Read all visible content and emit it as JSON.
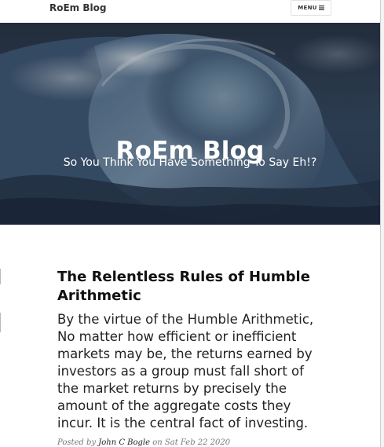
{
  "navbar": {
    "brand": "RoEm Blog",
    "menu_label": "MENU",
    "menu_icon": "hamburger-icon"
  },
  "header": {
    "title": "RoEm Blog",
    "subtitle": "So You Think You Have Something To Say Eh!?",
    "background": "ocean-wave-image"
  },
  "post": {
    "title": "The Relentless Rules of Humble Arithmetic",
    "subtitle": "By the virtue of the Humble Arithmetic, No matter how efficient or inefficient markets may be, the returns earned by investors as a group must fall short of the market returns by precisely the amount of the aggregate costs they incur. It is the central fact of investing.",
    "meta_prefix": "Posted by",
    "author": "John C Bogle",
    "meta_date_prefix": "on",
    "date": "Sat Feb 22 2020"
  },
  "colors": {
    "text_dark": "#111111",
    "header_text": "#ffffff",
    "meta": "#777777"
  }
}
